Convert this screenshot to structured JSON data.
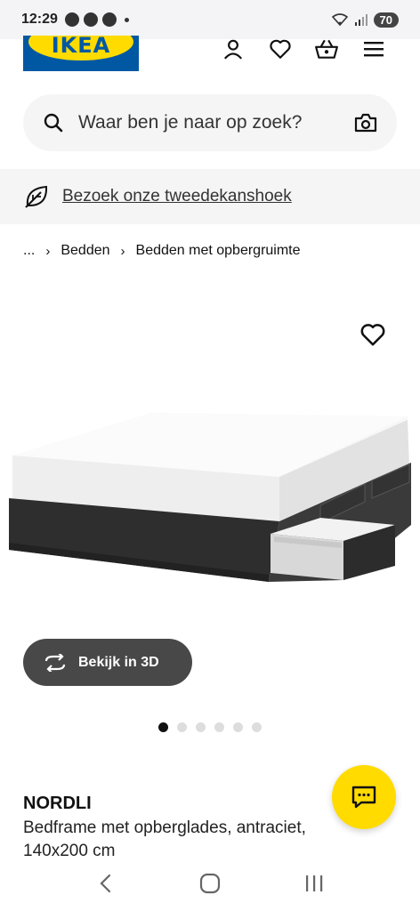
{
  "status_bar": {
    "time": "12:29",
    "battery": "70"
  },
  "header": {
    "logo_text": "IKEA",
    "icons": [
      "account-icon",
      "heart-icon",
      "basket-icon",
      "menu-icon"
    ]
  },
  "search": {
    "placeholder": "Waar ben je naar op zoek?"
  },
  "promo": {
    "link_text": "Bezoek onze tweedekanshoek"
  },
  "breadcrumb": {
    "ellipsis": "...",
    "items": [
      "Bedden",
      "Bedden met opbergruimte"
    ]
  },
  "gallery": {
    "view3d_label": "Bekijk in 3D",
    "dot_count": 6,
    "active_index": 0
  },
  "product": {
    "name": "NORDLI",
    "description": "Bedframe met opberglades, antraciet, 140x200 cm"
  },
  "colors": {
    "ikea_blue": "#0058a3",
    "ikea_yellow": "#ffdb00",
    "button_dark": "#484848"
  }
}
